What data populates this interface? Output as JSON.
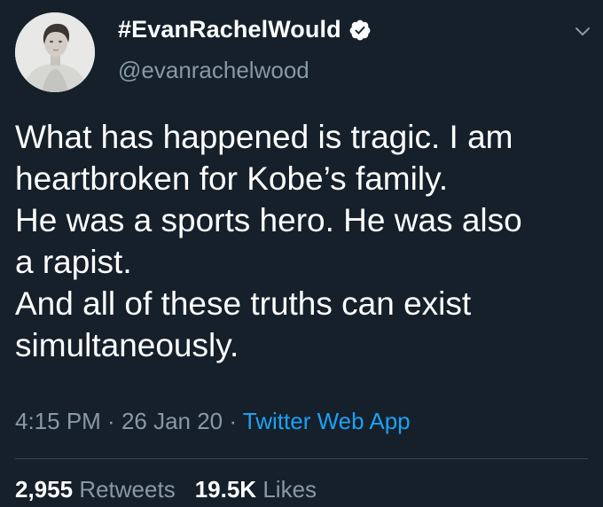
{
  "user": {
    "display_name": "#EvanRachelWould",
    "handle": "@evanrachelwood",
    "verified_icon": "verified-badge-icon",
    "avatar_icon": "profile-photo"
  },
  "tweet": {
    "text": "What has happened is tragic. I am\nheartbroken for Kobe’s family.\nHe was a sports hero. He was also\na rapist.\nAnd all of these truths can exist\nsimultaneously."
  },
  "meta": {
    "time": "4:15 PM",
    "sep1": " · ",
    "date": "26 Jan 20",
    "sep2": " · ",
    "source": "Twitter Web App"
  },
  "stats": {
    "retweets_count": "2,955",
    "retweets_label": "Retweets",
    "likes_count": "19.5K",
    "likes_label": "Likes"
  },
  "colors": {
    "background": "#15202b",
    "secondary_text": "#8899a6",
    "accent": "#1da1f2",
    "divider": "#38444d"
  },
  "icons": {
    "menu": "chevron-down-icon"
  }
}
